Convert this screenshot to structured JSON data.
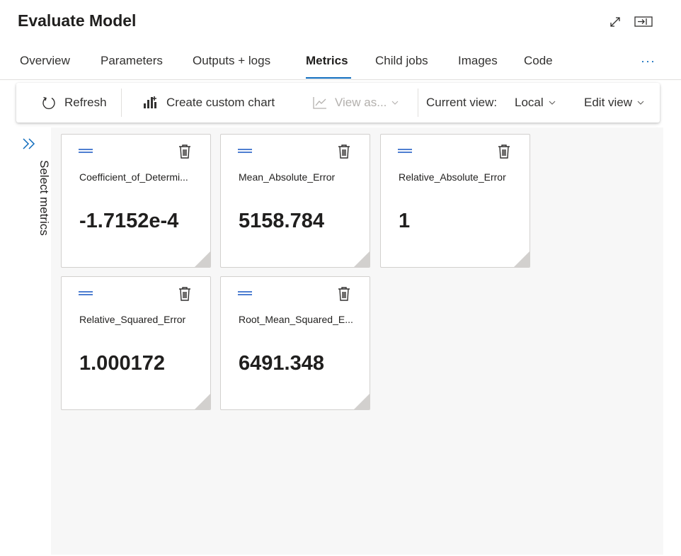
{
  "header": {
    "title": "Evaluate Model",
    "expand_icon": "expand-diagonal-icon",
    "open_panel_icon": "open-pane-icon"
  },
  "tabs": [
    {
      "label": "Overview",
      "active": false
    },
    {
      "label": "Parameters",
      "active": false
    },
    {
      "label": "Outputs + logs",
      "active": false
    },
    {
      "label": "Metrics",
      "active": true
    },
    {
      "label": "Child jobs",
      "active": false
    },
    {
      "label": "Images",
      "active": false
    },
    {
      "label": "Code",
      "active": false
    }
  ],
  "more_label": "···",
  "toolbar": {
    "refresh_label": "Refresh",
    "custom_chart_label": "Create custom chart",
    "view_as_label": "View as...",
    "current_view_label": "Current view:",
    "current_view_value": "Local",
    "edit_view_label": "Edit view"
  },
  "sidebar": {
    "label": "Select metrics",
    "icon": "double-chevron-right-icon"
  },
  "metrics": [
    {
      "name": "Coefficient_of_Determi...",
      "value": "-1.7152e-4"
    },
    {
      "name": "Mean_Absolute_Error",
      "value": "5158.784"
    },
    {
      "name": "Relative_Absolute_Error",
      "value": "1"
    },
    {
      "name": "Relative_Squared_Error",
      "value": "1.000172"
    },
    {
      "name": "Root_Mean_Squared_E...",
      "value": "6491.348"
    }
  ],
  "colors": {
    "accent": "#0f6cbd",
    "drag_handle": "#4f7fd1",
    "canvas_bg": "#f7f7f7",
    "disabled_text": "#b3b0ad"
  }
}
